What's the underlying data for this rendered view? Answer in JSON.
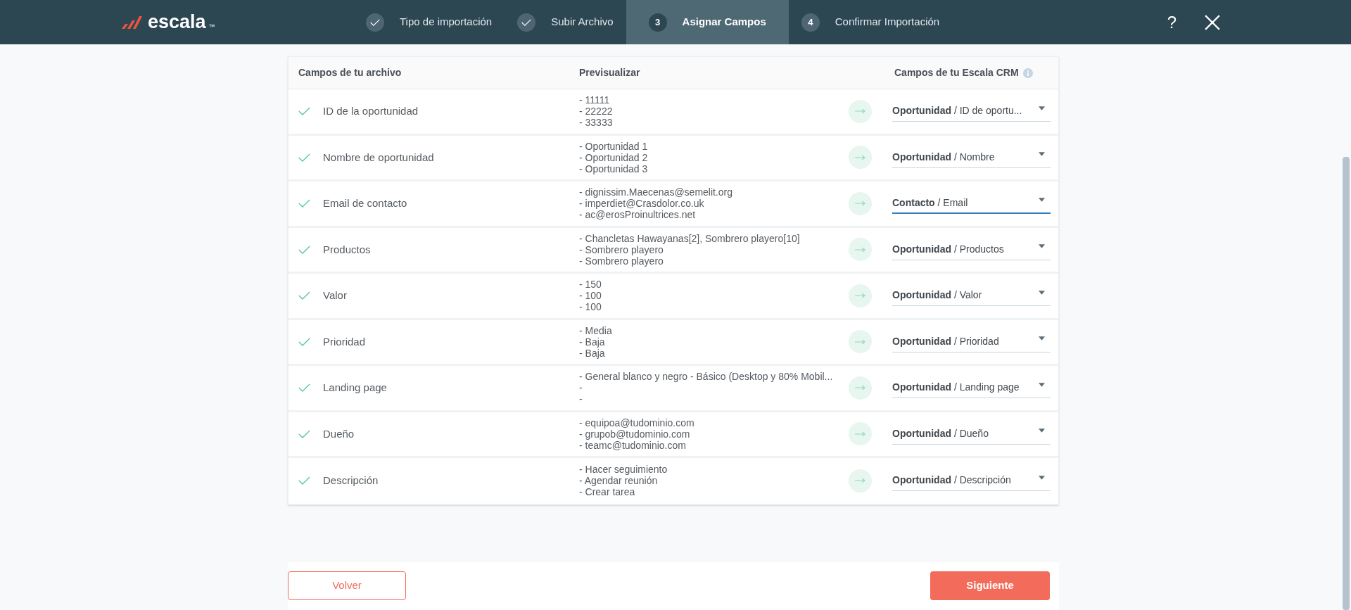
{
  "header": {
    "logo": {
      "text": "escala",
      "mark": "™"
    },
    "steps": [
      {
        "kind": "done",
        "label": "Tipo de importación"
      },
      {
        "kind": "done",
        "label": "Subir Archivo"
      },
      {
        "kind": "active",
        "number": "3",
        "label": "Asignar Campos"
      },
      {
        "kind": "pending",
        "number": "4",
        "label": "Confirmar Importación"
      }
    ],
    "help": "?"
  },
  "table": {
    "columns": [
      "Campos de tu archivo",
      "Previsualizar",
      "Campos de tu Escala CRM"
    ],
    "rows": [
      {
        "mapped": true,
        "field": "ID de la oportunidad",
        "preview": [
          "- 11111",
          "- 22222",
          "- 33333"
        ],
        "target": {
          "value": "**Oportunidad** / ID de oportu...",
          "focused": false
        }
      },
      {
        "mapped": true,
        "field": "Nombre de oportunidad",
        "preview": [
          "- Oportunidad 1",
          "- Oportunidad 2",
          "- Oportunidad 3"
        ],
        "target": {
          "value": "**Oportunidad** / Nombre",
          "focused": false
        }
      },
      {
        "mapped": true,
        "field": "Email de contacto",
        "preview": [
          "- dignissim.Maecenas@semelit.org",
          "- imperdiet@Crasdolor.co.uk",
          "- ac@erosProinultrices.net"
        ],
        "target": {
          "value": "**Contacto** / Email",
          "focused": true
        }
      },
      {
        "mapped": true,
        "field": "Productos",
        "preview": [
          "- Chancletas Hawayanas[2], Sombrero playero[10]",
          "- Sombrero playero",
          "- Sombrero playero"
        ],
        "target": {
          "value": "**Oportunidad** / Productos",
          "focused": false
        }
      },
      {
        "mapped": true,
        "field": "Valor",
        "preview": [
          "- 150",
          "- 100",
          "- 100"
        ],
        "target": {
          "value": "**Oportunidad** / Valor",
          "focused": false
        }
      },
      {
        "mapped": true,
        "field": "Prioridad",
        "preview": [
          "- Media",
          "- Baja",
          "- Baja"
        ],
        "target": {
          "value": "**Oportunidad** / Prioridad",
          "focused": false
        }
      },
      {
        "mapped": true,
        "field": "Landing page",
        "preview": [
          "- General blanco y negro - Básico (Desktop y 80% Mobil...",
          "-",
          "-"
        ],
        "target": {
          "value": "**Oportunidad** / Landing page",
          "focused": false
        }
      },
      {
        "mapped": true,
        "field": "Dueño",
        "preview": [
          "- equipoa@tudominio.com",
          "- grupob@tudominio.com",
          "- teamc@tudominio.com"
        ],
        "target": {
          "value": "**Oportunidad** / Dueño",
          "focused": false
        }
      },
      {
        "mapped": true,
        "field": "Descripción",
        "preview": [
          "- Hacer seguimiento",
          "- Agendar reunión",
          "- Crear tarea"
        ],
        "target": {
          "value": "**Oportunidad** / Descripción",
          "focused": false
        }
      }
    ]
  },
  "footer": {
    "back": "Volver",
    "next": "Siguiente"
  }
}
